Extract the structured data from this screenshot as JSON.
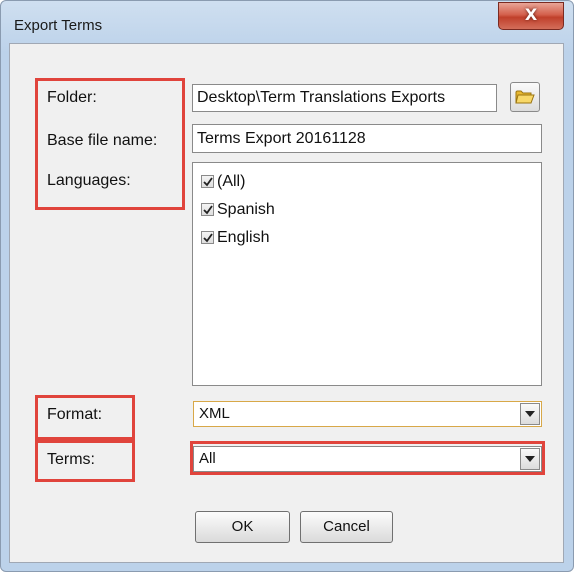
{
  "window": {
    "title": "Export Terms",
    "close_label": "X"
  },
  "form": {
    "folder_label": "Folder:",
    "folder_value": "Desktop\\Term Translations Exports",
    "base_file_label": "Base file name:",
    "base_file_value": "Terms Export 20161128",
    "languages_label": "Languages:",
    "languages": [
      {
        "label": "(All)",
        "checked": true
      },
      {
        "label": "Spanish",
        "checked": true
      },
      {
        "label": "English",
        "checked": true
      }
    ],
    "format_label": "Format:",
    "format_value": "XML",
    "terms_label": "Terms:",
    "terms_value": "All"
  },
  "buttons": {
    "ok": "OK",
    "cancel": "Cancel"
  },
  "colors": {
    "highlight": "#e0443c",
    "format_focus": "#e8c070"
  },
  "icons": {
    "browse": "folder-icon",
    "check": "check-icon",
    "dropdown": "chevron-down-icon"
  }
}
